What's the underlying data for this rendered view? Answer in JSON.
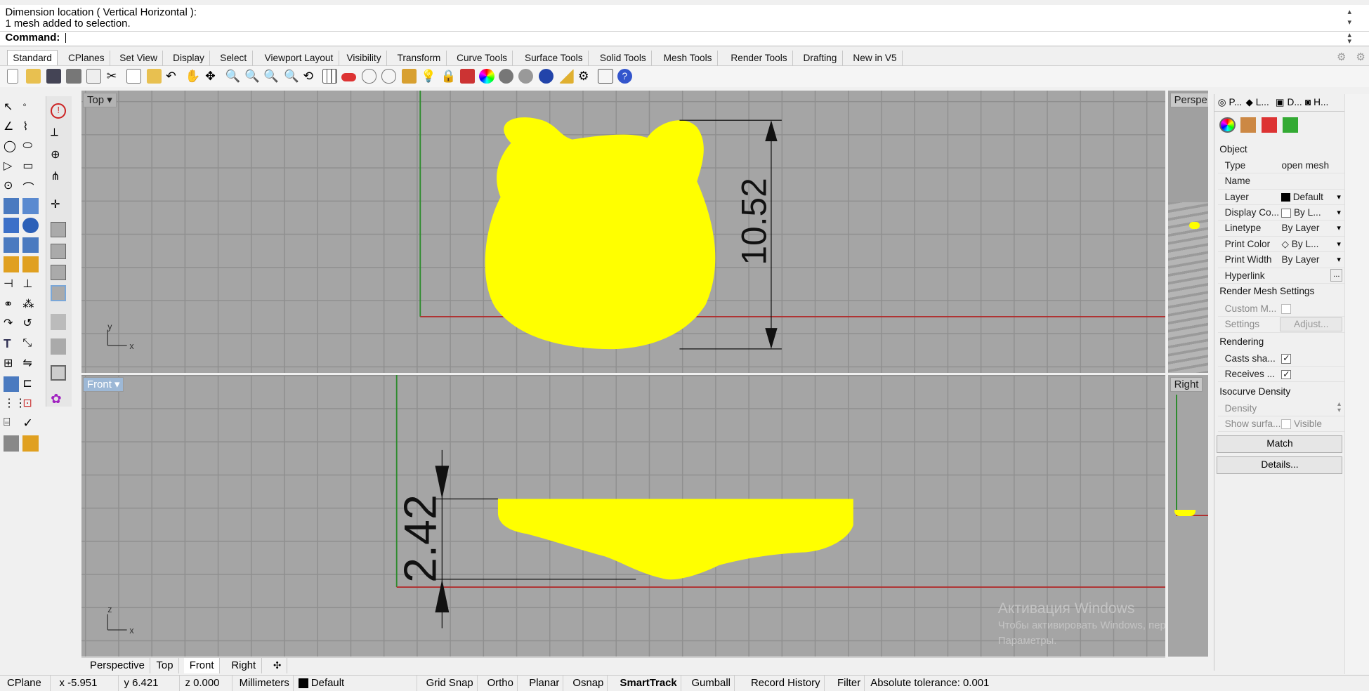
{
  "command": {
    "history_line1": "Dimension location ( Vertical  Horizontal ):",
    "history_line2": "1 mesh added to selection.",
    "prompt_label": "Command:"
  },
  "tabs": [
    "Standard",
    "CPlanes",
    "Set View",
    "Display",
    "Select",
    "Viewport Layout",
    "Visibility",
    "Transform",
    "Curve Tools",
    "Surface Tools",
    "Solid Tools",
    "Mesh Tools",
    "Render Tools",
    "Drafting",
    "New in V5"
  ],
  "viewports": {
    "top": {
      "label": "Top",
      "dimension": "10.52",
      "axis_y": "y",
      "axis_x": "x"
    },
    "front": {
      "label": "Front",
      "dimension": "2.42",
      "axis_z": "z",
      "axis_x": "x"
    },
    "perspective": {
      "label": "Perspe"
    },
    "right": {
      "label": "Right"
    }
  },
  "viewport_tabs": [
    "Perspective",
    "Top",
    "Front",
    "Right"
  ],
  "panel": {
    "tabs": [
      "P...",
      "L...",
      "D...",
      "H..."
    ],
    "section_object": "Object",
    "type_key": "Type",
    "type_val": "open mesh",
    "name_key": "Name",
    "layer_key": "Layer",
    "layer_val": "Default",
    "display_key": "Display Co...",
    "display_val": "By L...",
    "linetype_key": "Linetype",
    "linetype_val": "By Layer",
    "printcolor_key": "Print Color",
    "printcolor_val": "By L...",
    "printwidth_key": "Print Width",
    "printwidth_val": "By Layer",
    "hyperlink_key": "Hyperlink",
    "hyperlink_btn": "...",
    "section_render_mesh": "Render Mesh Settings",
    "custom_key": "Custom M...",
    "settings_key": "Settings",
    "settings_btn": "Adjust...",
    "section_rendering": "Rendering",
    "casts_key": "Casts sha...",
    "receives_key": "Receives ...",
    "section_isocurve": "Isocurve Density",
    "density_key": "Density",
    "showsurf_key": "Show surfa...",
    "showsurf_val": "Visible",
    "match_btn": "Match",
    "details_btn": "Details..."
  },
  "status": {
    "cplane": "CPlane",
    "x": "x -5.951",
    "y": "y 6.421",
    "z": "z 0.000",
    "units": "Millimeters",
    "layer": "Default",
    "grid_snap": "Grid Snap",
    "ortho": "Ortho",
    "planar": "Planar",
    "osnap": "Osnap",
    "smarttrack": "SmartTrack",
    "gumball": "Gumball",
    "record_history": "Record History",
    "filter": "Filter",
    "tolerance": "Absolute tolerance: 0.001"
  },
  "watermark": {
    "line1": "Активация Windows",
    "line2": "Чтобы активировать Windows, перейдите в раздел",
    "line3": "Параметры."
  },
  "colors": {
    "mesh": "#ffff00",
    "x_axis": "#b03030",
    "y_axis": "#2e8b2e",
    "active_label": "#9db8d6"
  }
}
